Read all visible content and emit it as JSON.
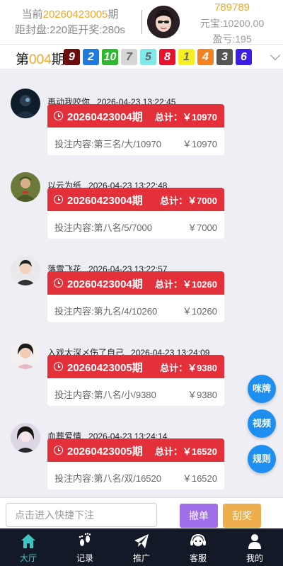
{
  "header": {
    "current_prefix": "当前",
    "current_issue": "20260423005",
    "current_suffix": "期",
    "countdown": "距封盘:220距开奖:280s",
    "user_id": "789789",
    "balance": "元宝:10200.00",
    "profit": "盈亏:195"
  },
  "period_bar": {
    "prefix": "第",
    "issue": "004",
    "suffix": "期",
    "balls": [
      {
        "n": "9",
        "color": "#6e0d0d"
      },
      {
        "n": "2",
        "color": "#1f7ae0"
      },
      {
        "n": "10",
        "color": "#2db82d"
      },
      {
        "n": "7",
        "color": "#d6d6d6"
      },
      {
        "n": "5",
        "color": "#7fe8ea"
      },
      {
        "n": "8",
        "color": "#e8122e"
      },
      {
        "n": "1",
        "color": "#f5ee24"
      },
      {
        "n": "4",
        "color": "#f58220"
      },
      {
        "n": "3",
        "color": "#555555"
      },
      {
        "n": "6",
        "color": "#3a1ee8"
      }
    ]
  },
  "posts": [
    {
      "user": "再动我咬你",
      "time": "2026-04-23 13:22:45",
      "issue": "20260423004期",
      "total": "总计：￥10970",
      "content": "投注内容:第三名/大/10970",
      "amount": "￥10970"
    },
    {
      "user": "以云为纸",
      "time": "2026-04-23 13:22:48",
      "issue": "20260423004期",
      "total": "总计：￥7000",
      "content": "投注内容:第八名/5/7000",
      "amount": "￥7000"
    },
    {
      "user": "落雪飞花",
      "time": "2026-04-23 13:22:57",
      "issue": "20260423004期",
      "total": "总计：￥10260",
      "content": "投注内容:第九名/4/10260",
      "amount": "￥10260"
    },
    {
      "user": "入戏太深〆伤了自己",
      "time": "2026-04-23 13:24:09",
      "issue": "20260423005期",
      "total": "总计：￥9380",
      "content": "投注内容:第八名/小/9380",
      "amount": "￥9380"
    },
    {
      "user": "血葬爱情",
      "time": "2026-04-23 13:24:14",
      "issue": "20260423005期",
      "total": "总计：￥16520",
      "content": "投注内容:第八名/双/16520",
      "amount": "￥16520"
    }
  ],
  "float_buttons": {
    "chat": "咪牌",
    "video": "视频",
    "rules": "规则"
  },
  "quick_bet": {
    "placeholder": "点击进入快捷下注",
    "cancel_label": "撤单",
    "scratch_label": "刮奖"
  },
  "tabbar": {
    "hall": "大厅",
    "records": "记录",
    "promote": "推广",
    "service": "客服",
    "mine": "我的",
    "active_color": "#3fc4c4"
  }
}
